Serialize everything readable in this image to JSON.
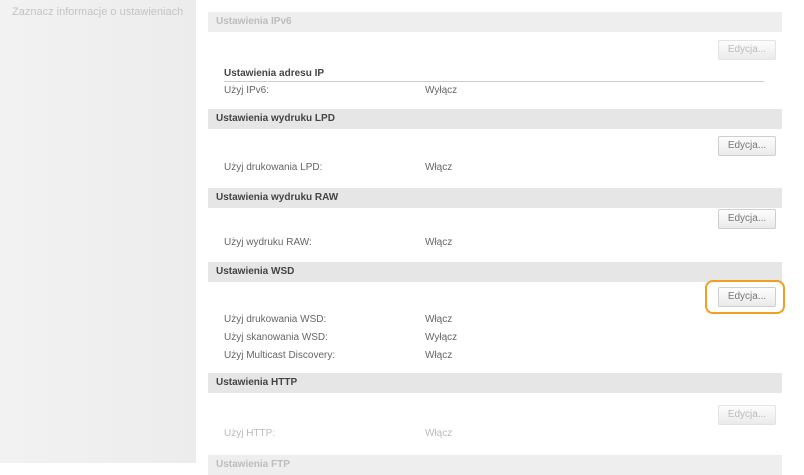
{
  "sidebar": {
    "text": "Zaznacz informacje o ustawieniach"
  },
  "sections": {
    "ipv6": {
      "header": "Ustawienia IPv6",
      "edit_label": "Edycja...",
      "subheader": "Ustawienia adresu IP",
      "rows": [
        {
          "label": "Użyj IPv6:",
          "value": "Wyłącz"
        }
      ]
    },
    "lpd": {
      "header": "Ustawienia wydruku LPD",
      "edit_label": "Edycja...",
      "rows": [
        {
          "label": "Użyj drukowania LPD:",
          "value": "Włącz"
        }
      ]
    },
    "raw": {
      "header": "Ustawienia wydruku RAW",
      "edit_label": "Edycja...",
      "rows": [
        {
          "label": "Użyj wydruku RAW:",
          "value": "Włącz"
        }
      ]
    },
    "wsd": {
      "header": "Ustawienia WSD",
      "edit_label": "Edycja...",
      "rows": [
        {
          "label": "Użyj drukowania WSD:",
          "value": "Włącz"
        },
        {
          "label": "Użyj skanowania WSD:",
          "value": "Wyłącz"
        },
        {
          "label": "Użyj Multicast Discovery:",
          "value": "Włącz"
        }
      ]
    },
    "http": {
      "header": "Ustawienia HTTP",
      "edit_label": "Edycja...",
      "rows": [
        {
          "label": "Użyj HTTP:",
          "value": "Włącz"
        }
      ]
    },
    "next": {
      "header": "Ustawienia FTP"
    }
  },
  "colors": {
    "highlight": "#f0a020",
    "header_bg": "#e6e6e6"
  }
}
